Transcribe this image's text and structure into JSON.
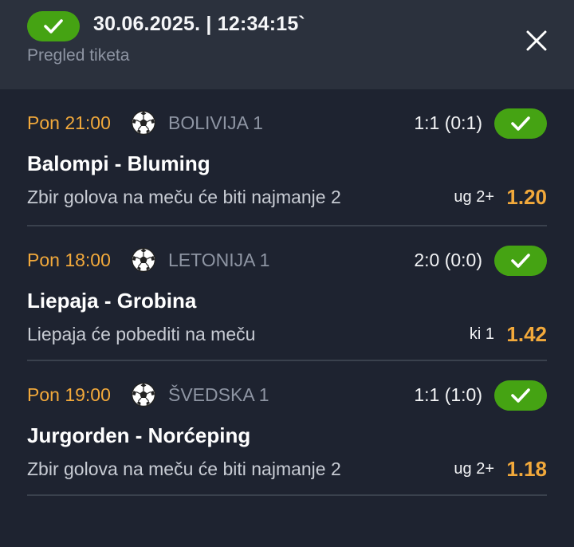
{
  "header": {
    "status_icon": "check-icon",
    "datetime": "30.06.2025. | 12:34:15`",
    "subtitle": "Pregled tiketa",
    "close_icon": "close-icon"
  },
  "colors": {
    "win": "#45a313",
    "accent": "#f2a93b",
    "background": "#1e2330",
    "header_bg": "#2b313d"
  },
  "events": [
    {
      "time": "Pon 21:00",
      "sport_icon": "soccer-ball-icon",
      "league": "BOLIVIJA 1",
      "score": "1:1 (0:1)",
      "status": "won",
      "teams": "Balompi - Bluming",
      "pick": "Zbir golova na meču će biti najmanje 2",
      "market": "ug 2+",
      "odds": "1.20"
    },
    {
      "time": "Pon 18:00",
      "sport_icon": "soccer-ball-icon",
      "league": "LETONIJA 1",
      "score": "2:0 (0:0)",
      "status": "won",
      "teams": "Liepaja - Grobina",
      "pick": "Liepaja će pobediti na meču",
      "market": "ki 1",
      "odds": "1.42"
    },
    {
      "time": "Pon 19:00",
      "sport_icon": "soccer-ball-icon",
      "league": "ŠVEDSKA 1",
      "score": "1:1 (1:0)",
      "status": "won",
      "teams": "Jurgorden - Norćeping",
      "pick": "Zbir golova na meču će biti najmanje 2",
      "market": "ug 2+",
      "odds": "1.18"
    }
  ]
}
